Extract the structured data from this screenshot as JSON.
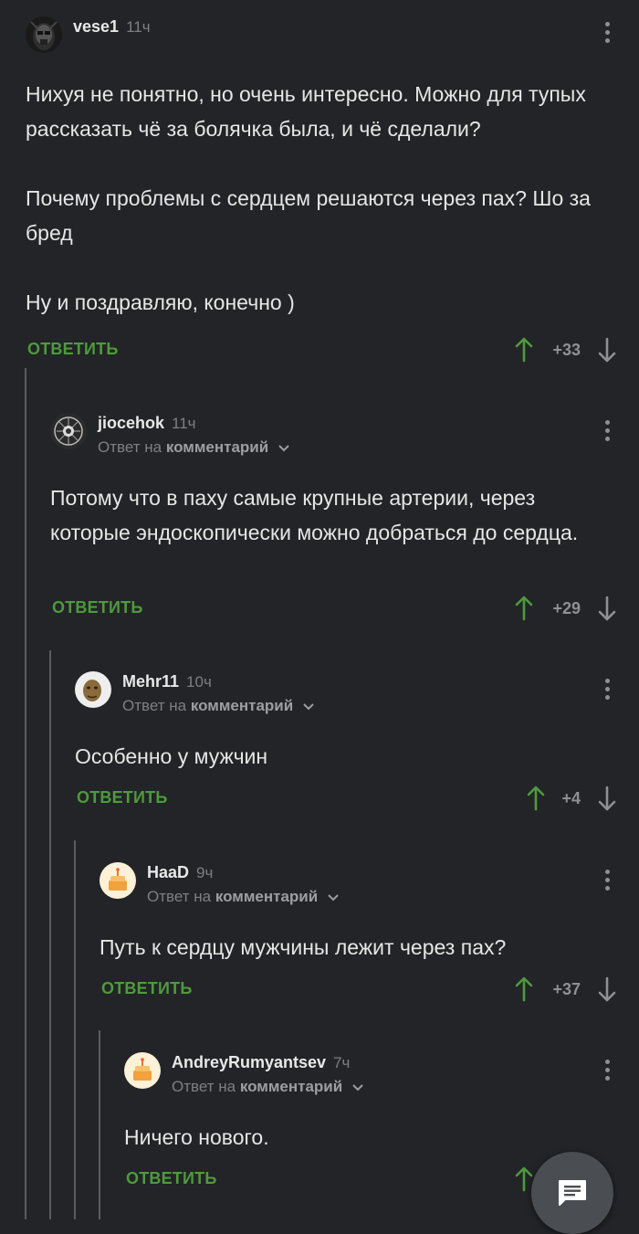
{
  "comments": [
    {
      "username": "vese1",
      "time": "11ч",
      "text": "Нихуя не понятно, но очень интересно. Можно для тупых рассказать чё за болячка была, и чё сделали?\n\nПочему проблемы с сердцем решаются через пах? Шо за бред\n\nНу и поздравляю, конечно )",
      "reply_label": "ОТВЕТИТЬ",
      "score": "+33",
      "avatar_icon": "skull-mask-avatar"
    },
    {
      "username": "jiocehok",
      "time": "11ч",
      "reply_prefix": "Ответ на",
      "reply_target": "комментарий",
      "text": "Потому что в паху самые крупные артерии, через которые эндоскопически можно добраться до сердца.",
      "reply_label": "ОТВЕТИТЬ",
      "score": "+29",
      "avatar_icon": "emblem-avatar"
    },
    {
      "username": "Mehr11",
      "time": "10ч",
      "reply_prefix": "Ответ на",
      "reply_target": "комментарий",
      "text": "Особенно у мужчин",
      "reply_label": "ОТВЕТИТЬ",
      "score": "+4",
      "avatar_icon": "face-avatar"
    },
    {
      "username": "HaaD",
      "time": "9ч",
      "reply_prefix": "Ответ на",
      "reply_target": "комментарий",
      "text": "Путь к сердцу мужчины лежит через пах?",
      "reply_label": "ОТВЕТИТЬ",
      "score": "+37",
      "avatar_icon": "default-cake-avatar"
    },
    {
      "username": "AndreyRumyantsev",
      "time": "7ч",
      "reply_prefix": "Ответ на",
      "reply_target": "комментарий",
      "text": "Ничего нового.",
      "reply_label": "ОТВЕТИТЬ",
      "avatar_icon": "default-cake-avatar"
    }
  ],
  "fab": {
    "icon": "comment-icon"
  },
  "colors": {
    "background": "#222427",
    "accent_green": "#4e9a3c",
    "muted_text": "#7d7f82"
  }
}
